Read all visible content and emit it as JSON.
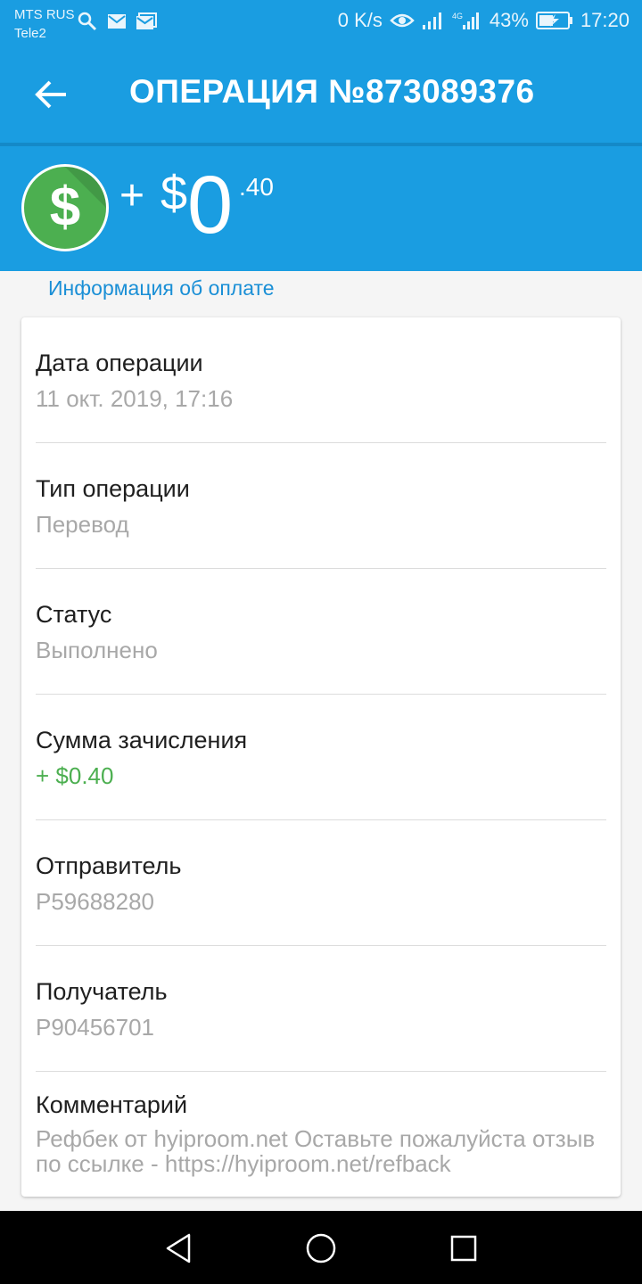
{
  "status_bar": {
    "carrier1": "MTS RUS",
    "carrier2": "Tele2",
    "net_speed": "0 K/s",
    "battery": "43%",
    "time": "17:20"
  },
  "app_bar": {
    "title": "ОПЕРАЦИЯ №873089376"
  },
  "amount": {
    "sign": "+",
    "currency": "$",
    "integer": "0",
    "cents": ".40"
  },
  "section": {
    "title": "Информация об оплате"
  },
  "details": [
    {
      "label": "Дата операции",
      "value": "11 окт. 2019, 17:16"
    },
    {
      "label": "Тип операции",
      "value": "Перевод"
    },
    {
      "label": "Статус",
      "value": "Выполнено"
    },
    {
      "label": "Сумма зачисления",
      "value": "+ $0.40"
    },
    {
      "label": "Отправитель",
      "value": "P59688280"
    },
    {
      "label": "Получатель",
      "value": "P90456701"
    },
    {
      "label": "Комментарий",
      "value": "Рефбек от hyiproom.net  Оставьте пожалуйста отзыв по ссылке - https://hyiproom.net/refback"
    }
  ],
  "colors": {
    "primary": "#1a9de1",
    "accent_green": "#4caf50",
    "link": "#1a8fd6"
  }
}
